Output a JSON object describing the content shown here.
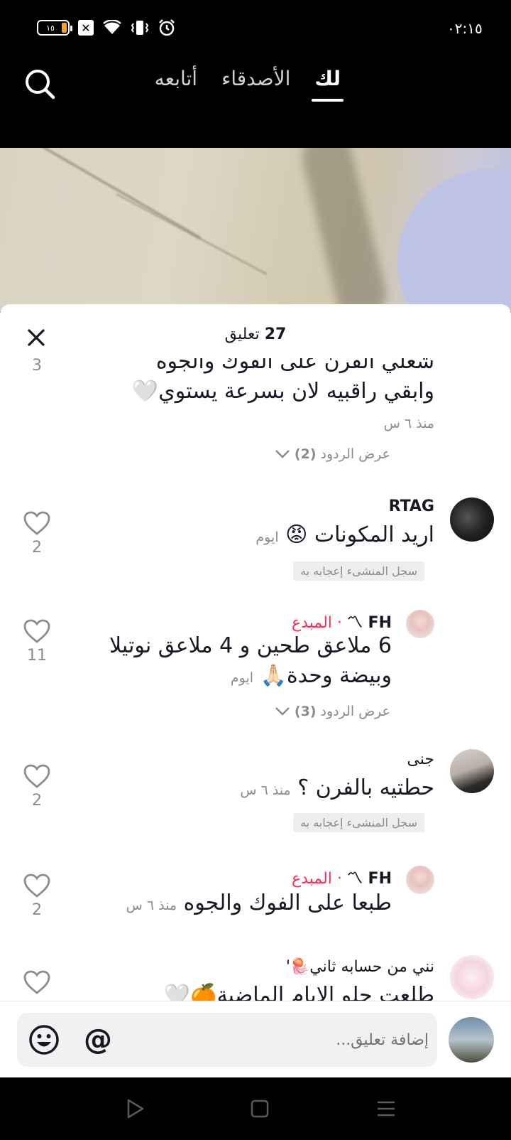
{
  "status_bar": {
    "time": "٠٢:١٥",
    "battery_level": "١٥",
    "icons": [
      "battery-icon",
      "sim-off-icon",
      "wifi-icon",
      "vibrate-icon",
      "alarm-icon"
    ]
  },
  "top_nav": {
    "tabs": [
      {
        "label": "أتابعه",
        "active": false
      },
      {
        "label": "الأصدقاء",
        "active": false
      },
      {
        "label": "لك",
        "active": true
      }
    ]
  },
  "sheet": {
    "count": "27",
    "count_label": "تعليق"
  },
  "comments": [
    {
      "text_line1": "شعلي الفرن على الفوك والجوه",
      "text_line2": "وابقي راقبيه لان بسرعة يستوي🤍",
      "time": "منذ ٦ س",
      "likes": "3",
      "replies_label": "عرض الردود",
      "replies_count": "(2)"
    },
    {
      "username": "RTAG",
      "text": "اريد المكونات 😡",
      "time": "ايوم",
      "liked_badge": "سجل المنشىء إعجابه به",
      "likes": "2"
    },
    {
      "username": "FH 〽",
      "creator_label": "· المبدع",
      "text_line1": "6 ملاعق طحين و 4 ملاعق نوتيلا",
      "text_line2": "وبيضة وحدة🙏🏻",
      "time": "ايوم",
      "likes": "11",
      "replies_label": "عرض الردود",
      "replies_count": "(3)"
    },
    {
      "username": "جنى",
      "text": "حطتيه بالفرن ؟",
      "time": "منذ ٦ س",
      "liked_badge": "سجل المنشىء إعجابه به",
      "likes": "2"
    },
    {
      "username": "FH 〽",
      "creator_label": "· المبدع",
      "text": "طبعا على الفوك والجوه",
      "time": "منذ ٦ س",
      "likes": "2"
    },
    {
      "username": "نني من حسابه ثاني🪼'",
      "text": "طلعت حلو الايام الماضية🍊🤍",
      "likes": ""
    }
  ],
  "input": {
    "placeholder": "إضافة تعليق...",
    "mention_symbol": "@"
  },
  "colors": {
    "creator": "#fe2c55",
    "text": "#161823",
    "muted": "#8a8b91"
  }
}
